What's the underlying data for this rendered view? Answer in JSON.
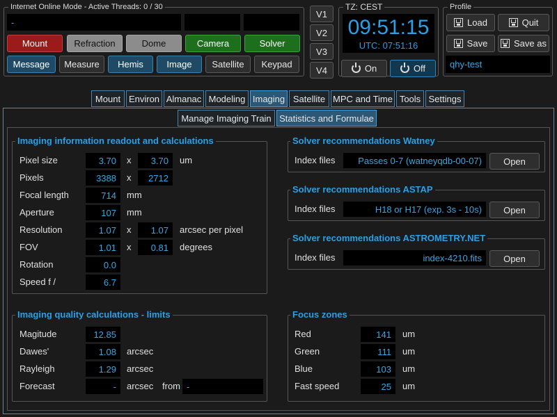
{
  "status": {
    "title": "Internet Online Mode  -  Active Threads:  0 / 30",
    "message_field": "-"
  },
  "top_buttons_row1": [
    "Mount",
    "Refraction",
    "Dome",
    "Camera",
    "Solver"
  ],
  "top_buttons_row2": [
    "Message",
    "Measure",
    "Hemis",
    "Image",
    "Satellite",
    "Keypad"
  ],
  "views": [
    "V1",
    "V2",
    "V3",
    "V4"
  ],
  "clock": {
    "tz_label": "TZ: CEST",
    "time": "09:51:15",
    "utc": "UTC:  07:51:16",
    "on_label": "On",
    "off_label": "Off"
  },
  "profile": {
    "title": "Profile",
    "load": "Load",
    "quit": "Quit",
    "save": "Save",
    "save_as": "Save as",
    "name": "qhy-test"
  },
  "main_tabs": [
    "Mount",
    "Environ",
    "Almanac",
    "Modeling",
    "Imaging",
    "Satellite",
    "MPC and Time",
    "Tools",
    "Settings"
  ],
  "sub_tabs": [
    "Manage Imaging Train",
    "Statistics and Formulae"
  ],
  "imaging_info": {
    "title": "Imaging information readout and calculations",
    "pixel_size": {
      "label": "Pixel size",
      "x": "3.70",
      "sep": "x",
      "y": "3.70",
      "unit": "um"
    },
    "pixels": {
      "label": "Pixels",
      "x": "3388",
      "sep": "x",
      "y": "2712"
    },
    "focal_length": {
      "label": "Focal length",
      "value": "714",
      "unit": "mm"
    },
    "aperture": {
      "label": "Aperture",
      "value": "107",
      "unit": "mm"
    },
    "resolution": {
      "label": "Resolution",
      "x": "1.07",
      "sep": "x",
      "y": "1.07",
      "unit": "arcsec per pixel"
    },
    "fov": {
      "label": "FOV",
      "x": "1.01",
      "sep": "x",
      "y": "0.81",
      "unit": "degrees"
    },
    "rotation": {
      "label": "Rotation",
      "value": "0.0"
    },
    "speed": {
      "label": "Speed  f /",
      "value": "6.7"
    }
  },
  "quality": {
    "title": "Imaging quality calculations - limits",
    "magnitude": {
      "label": "Magitude",
      "value": "12.85"
    },
    "dawes": {
      "label": "Dawes'",
      "value": "1.08",
      "unit": "arcsec"
    },
    "rayleigh": {
      "label": "Rayleigh",
      "value": "1.29",
      "unit": "arcsec"
    },
    "forecast": {
      "label": "Forecast",
      "value": "-",
      "unit": "arcsec",
      "from_label": "from",
      "from_value": "-"
    }
  },
  "watney": {
    "title": "Solver recommendations Watney",
    "label": "Index files",
    "value": "Passes 0-7 (watneyqdb-00-07)",
    "button": "Open"
  },
  "astap": {
    "title": "Solver recommendations ASTAP",
    "label": "Index files",
    "value": "H18 or H17 (exp. 3s - 10s)",
    "button": "Open"
  },
  "astrometry": {
    "title": "Solver recommendations ASTROMETRY.NET",
    "label": "Index files",
    "value": "index-4210.fits",
    "button": "Open"
  },
  "focus": {
    "title": "Focus zones",
    "red": {
      "label": "Red",
      "value": "141",
      "unit": "um"
    },
    "green": {
      "label": "Green",
      "value": "111",
      "unit": "um"
    },
    "blue": {
      "label": "Blue",
      "value": "103",
      "unit": "um"
    },
    "fast": {
      "label": "Fast speed",
      "value": "25",
      "unit": "um"
    }
  },
  "colors": {
    "accent": "#2aa0e6",
    "value_text": "#35a8e6",
    "background": "#1b1b1b"
  }
}
